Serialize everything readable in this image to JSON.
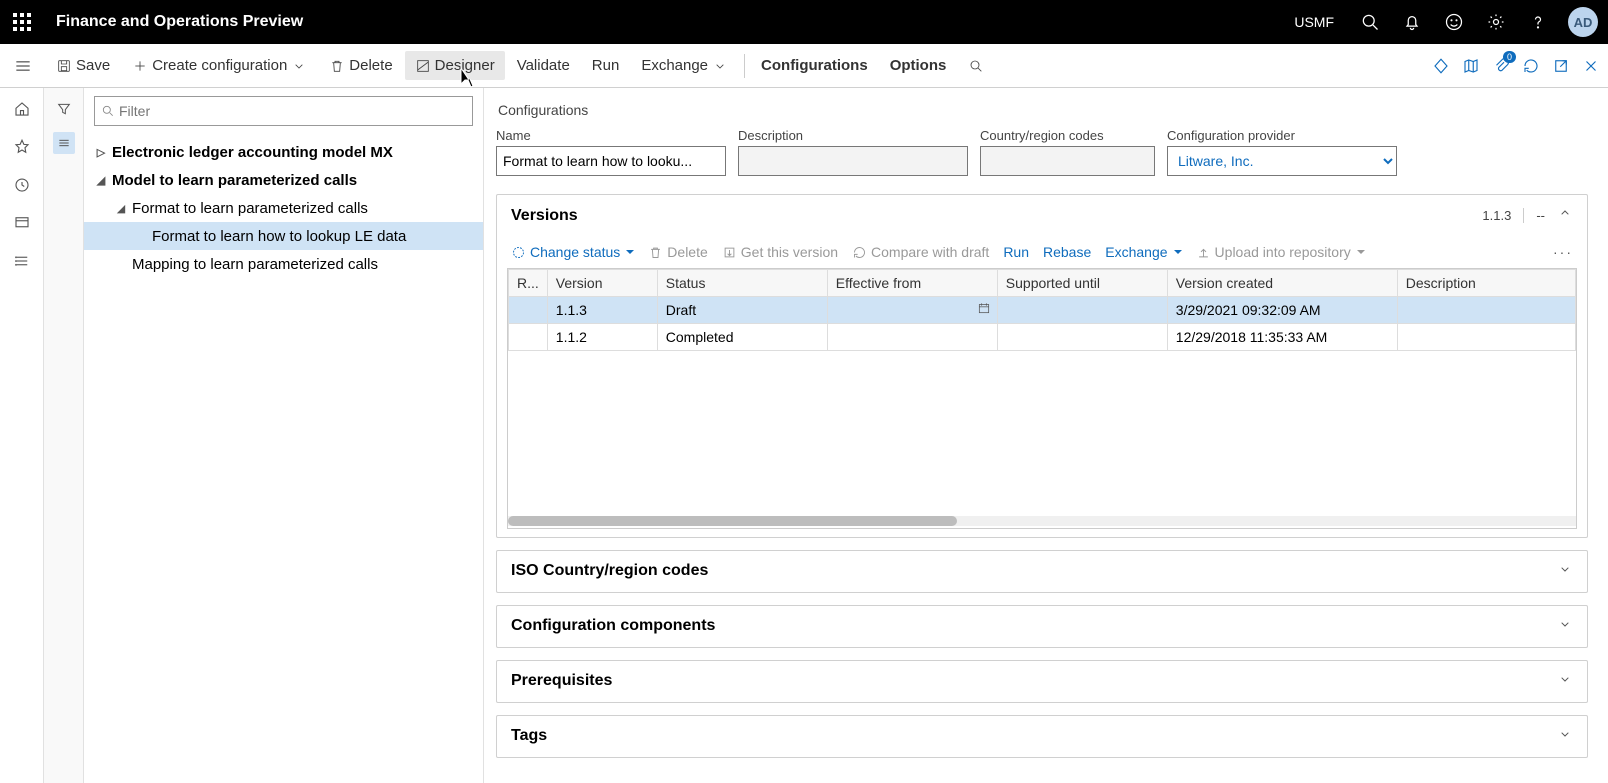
{
  "header": {
    "app_title": "Finance and Operations Preview",
    "company": "USMF",
    "avatar": "AD"
  },
  "actions": {
    "save": "Save",
    "create": "Create configuration",
    "delete": "Delete",
    "designer": "Designer",
    "validate": "Validate",
    "run": "Run",
    "exchange": "Exchange",
    "configurations": "Configurations",
    "options": "Options",
    "attachments_badge": "0"
  },
  "filter": {
    "placeholder": "Filter"
  },
  "tree": {
    "n0": "Electronic ledger accounting model MX",
    "n1": "Model to learn parameterized calls",
    "n2": "Format to learn parameterized calls",
    "n3": "Format to learn how to lookup LE data",
    "n4": "Mapping to learn parameterized calls"
  },
  "details": {
    "breadcrumb": "Configurations",
    "labels": {
      "name": "Name",
      "description": "Description",
      "ccr": "Country/region codes",
      "provider": "Configuration provider"
    },
    "values": {
      "name": "Format to learn how to looku...",
      "description": "",
      "ccr": "",
      "provider": "Litware, Inc."
    }
  },
  "versions": {
    "title": "Versions",
    "current": "1.1.3",
    "dashes": "--",
    "toolbar": {
      "change_status": "Change status",
      "delete": "Delete",
      "get": "Get this version",
      "compare": "Compare with draft",
      "run": "Run",
      "rebase": "Rebase",
      "exchange": "Exchange",
      "upload": "Upload into repository"
    },
    "columns": {
      "r": "R...",
      "version": "Version",
      "status": "Status",
      "effective": "Effective from",
      "supported": "Supported until",
      "created": "Version created",
      "description": "Description"
    },
    "rows": [
      {
        "version": "1.1.3",
        "status": "Draft",
        "effective": "",
        "supported": "",
        "created": "3/29/2021 09:32:09 AM",
        "description": ""
      },
      {
        "version": "1.1.2",
        "status": "Completed",
        "effective": "",
        "supported": "",
        "created": "12/29/2018 11:35:33 AM",
        "description": ""
      }
    ]
  },
  "sections": {
    "iso": "ISO Country/region codes",
    "components": "Configuration components",
    "prereq": "Prerequisites",
    "tags": "Tags"
  }
}
